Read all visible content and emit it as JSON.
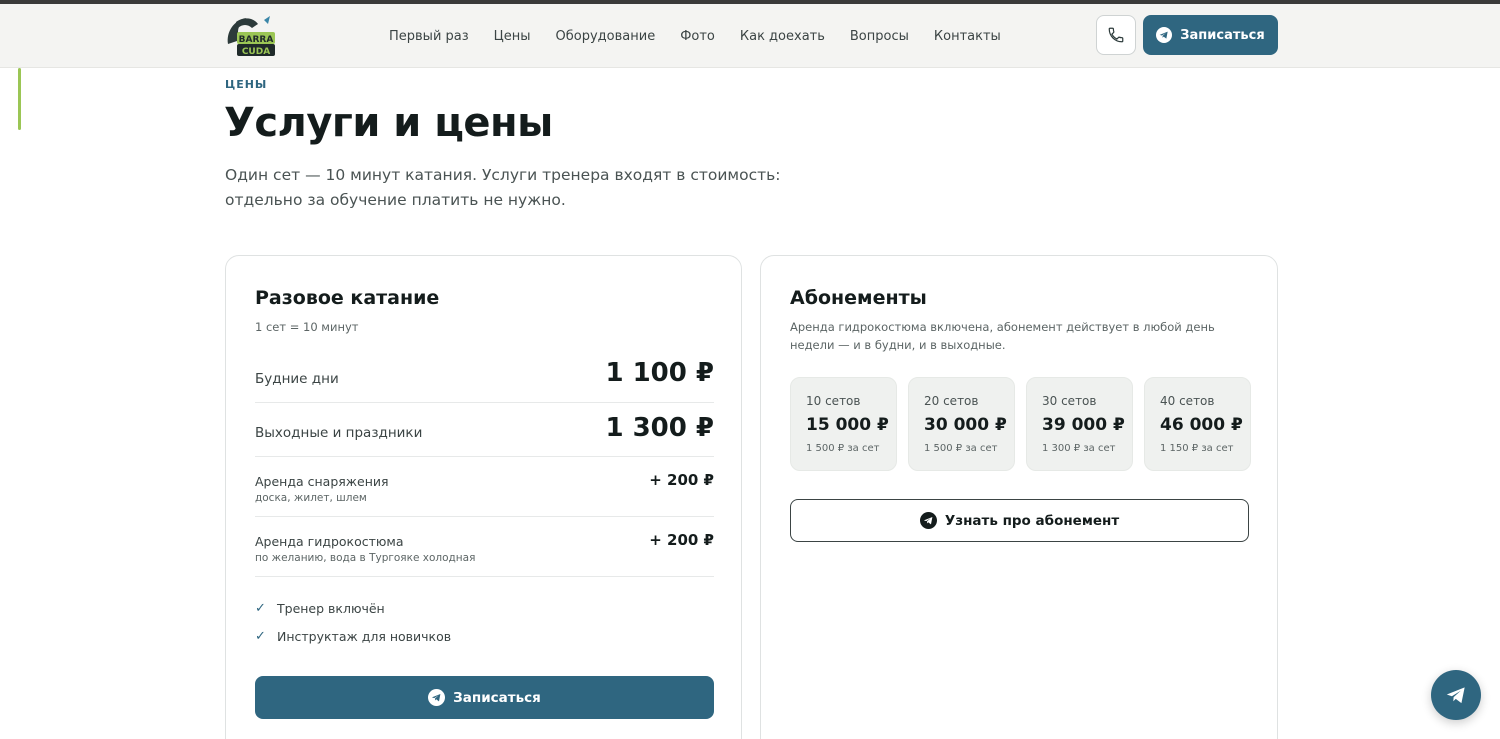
{
  "header": {
    "logo_text": [
      "BARRA",
      "CUDA"
    ],
    "nav": [
      {
        "label": "Первый раз"
      },
      {
        "label": "Цены"
      },
      {
        "label": "Оборудование"
      },
      {
        "label": "Фото"
      },
      {
        "label": "Как доехать"
      },
      {
        "label": "Вопросы"
      },
      {
        "label": "Контакты"
      }
    ],
    "phone_icon": "phone-icon",
    "signup_label": "Записаться"
  },
  "hero": {
    "eyebrow": "ЦЕНЫ",
    "title": "Услуги и цены",
    "lead": "Один сет — 10 минут катания. Услуги тренера входят в стоимость: отдельно за обучение платить не нужно."
  },
  "single": {
    "title": "Разовое катание",
    "subtitle": "1 сет = 10 минут",
    "rows": [
      {
        "label": "Будние дни",
        "price": "1 100 ₽"
      },
      {
        "label": "Выходные и праздники",
        "price": "1 300 ₽"
      },
      {
        "label": "Аренда снаряжения",
        "note": "доска, жилет, шлем",
        "price": "+ 200 ₽"
      },
      {
        "label": "Аренда гидрокостюма",
        "note": "по желанию, вода в Тургояке холодная",
        "price": "+ 200 ₽"
      }
    ],
    "checks": [
      {
        "label": "Тренер включён"
      },
      {
        "label": "Инструктаж для новичков"
      }
    ],
    "cta": "Записаться"
  },
  "subscriptions": {
    "title": "Абонементы",
    "subtitle": "Аренда гидрокостюма включена, абонемент действует в любой день недели — и в будни, и в выходные.",
    "plans": [
      {
        "sets": "10 сетов",
        "amount": "15 000 ₽",
        "per": "1 500 ₽ за сет"
      },
      {
        "sets": "20 сетов",
        "amount": "30 000 ₽",
        "per": "1 500 ₽ за сет"
      },
      {
        "sets": "30 сетов",
        "amount": "39 000 ₽",
        "per": "1 300 ₽ за сет"
      },
      {
        "sets": "40 сетов",
        "amount": "46 000 ₽",
        "per": "1 150 ₽ за сет"
      }
    ],
    "cta": "Узнать про абонемент"
  },
  "colors": {
    "primary": "#2f6680",
    "accent": "#9bc655",
    "text": "#141c1c",
    "muted": "#5c6565",
    "card_bg": "#eff1ef"
  }
}
